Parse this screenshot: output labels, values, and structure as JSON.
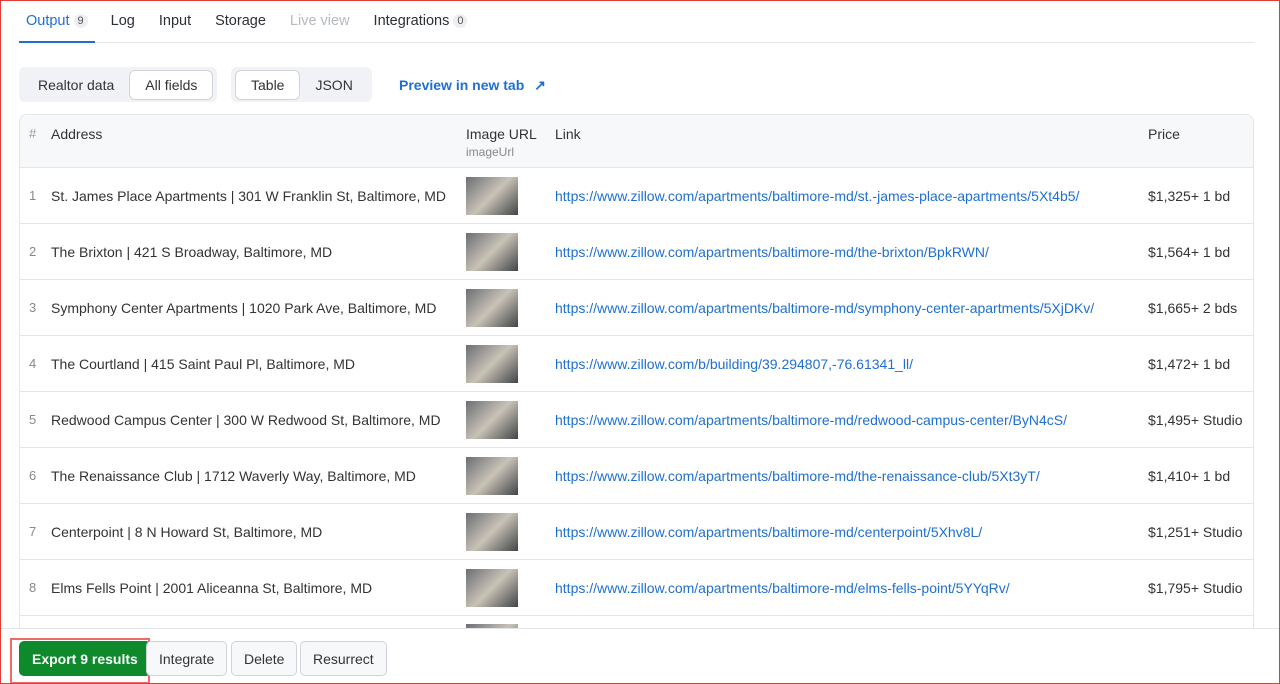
{
  "tabs": [
    {
      "label": "Output",
      "badge": "9"
    },
    {
      "label": "Log"
    },
    {
      "label": "Input"
    },
    {
      "label": "Storage"
    },
    {
      "label": "Live view"
    },
    {
      "label": "Integrations",
      "badge": "0"
    }
  ],
  "toolbar": {
    "view1": "Realtor data",
    "view2": "All fields",
    "format1": "Table",
    "format2": "JSON",
    "preview": "Preview in new tab"
  },
  "table": {
    "headers": {
      "num": "#",
      "address": "Address",
      "image": "Image URL",
      "image_sub": "imageUrl",
      "link": "Link",
      "price": "Price"
    },
    "rows": [
      {
        "n": "1",
        "address": "St. James Place Apartments | 301 W Franklin St, Baltimore, MD",
        "link": "https://www.zillow.com/apartments/baltimore-md/st.-james-place-apartments/5Xt4b5/",
        "price": "$1,325+ 1 bd"
      },
      {
        "n": "2",
        "address": "The Brixton | 421 S Broadway, Baltimore, MD",
        "link": "https://www.zillow.com/apartments/baltimore-md/the-brixton/BpkRWN/",
        "price": "$1,564+ 1 bd"
      },
      {
        "n": "3",
        "address": "Symphony Center Apartments | 1020 Park Ave, Baltimore, MD",
        "link": "https://www.zillow.com/apartments/baltimore-md/symphony-center-apartments/5XjDKv/",
        "price": "$1,665+ 2 bds"
      },
      {
        "n": "4",
        "address": "The Courtland | 415 Saint Paul Pl, Baltimore, MD",
        "link": "https://www.zillow.com/b/building/39.294807,-76.61341_ll/",
        "price": "$1,472+ 1 bd"
      },
      {
        "n": "5",
        "address": "Redwood Campus Center | 300 W Redwood St, Baltimore, MD",
        "link": "https://www.zillow.com/apartments/baltimore-md/redwood-campus-center/ByN4cS/",
        "price": "$1,495+ Studio"
      },
      {
        "n": "6",
        "address": "The Renaissance Club | 1712 Waverly Way, Baltimore, MD",
        "link": "https://www.zillow.com/apartments/baltimore-md/the-renaissance-club/5Xt3yT/",
        "price": "$1,410+ 1 bd"
      },
      {
        "n": "7",
        "address": "Centerpoint | 8 N Howard St, Baltimore, MD",
        "link": "https://www.zillow.com/apartments/baltimore-md/centerpoint/5Xhv8L/",
        "price": "$1,251+ Studio"
      },
      {
        "n": "8",
        "address": "Elms Fells Point | 2001 Aliceanna St, Baltimore, MD",
        "link": "https://www.zillow.com/apartments/baltimore-md/elms-fells-point/5YYqRv/",
        "price": "$1,795+ Studio"
      }
    ]
  },
  "footer": {
    "export": "Export 9 results",
    "integrate": "Integrate",
    "delete": "Delete",
    "resurrect": "Resurrect"
  }
}
